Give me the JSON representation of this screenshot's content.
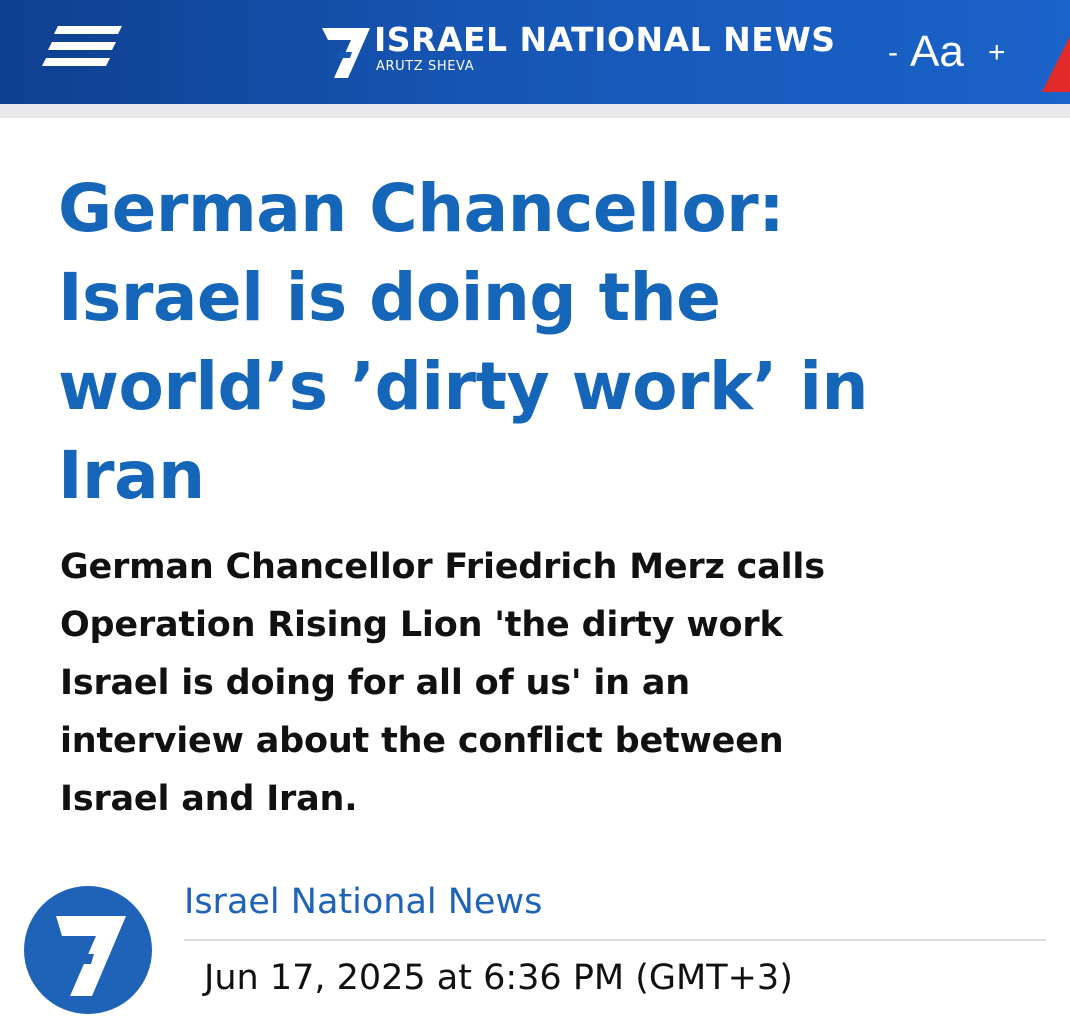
{
  "header": {
    "brand_title": "ISRAEL NATIONAL NEWS",
    "brand_subtitle": "ARUTZ SHEVA",
    "font_decrease": "-",
    "font_label": "Aa",
    "font_increase": "+",
    "icons": {
      "menu": "menu-icon",
      "brand": "seven-logo-icon"
    },
    "colors": {
      "bar_start": "#0f3f8f",
      "bar_end": "#1a63c8",
      "flag": "#e32a2a"
    }
  },
  "article": {
    "headline_lines": [
      "German Chancellor:",
      "Israel is doing the",
      "world’s ’dirty work’ in",
      "Iran"
    ],
    "subheadline_lines": [
      "German Chancellor Friedrich Merz calls",
      "Operation Rising Lion 'the dirty work",
      "Israel is doing for all of us' in an",
      "interview about the conflict between",
      "Israel and Iran."
    ],
    "colors": {
      "headline": "#1565b8",
      "subheadline": "#111111"
    }
  },
  "byline": {
    "source": "Israel National News",
    "date": "Jun 17, 2025 at 6:36 PM (GMT+3)",
    "avatar_icon": "seven-logo-icon",
    "colors": {
      "avatar": "#1f63b8",
      "source": "#1f63b8"
    }
  }
}
